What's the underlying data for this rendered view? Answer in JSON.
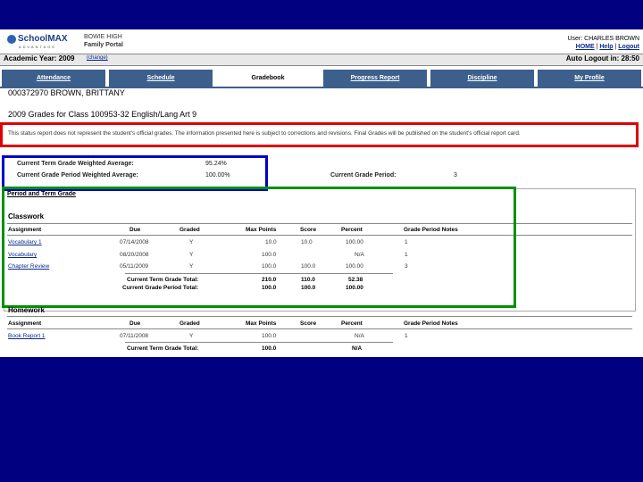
{
  "header": {
    "logo_main": "SchoolMAX",
    "logo_sub": "ADVANTAGE",
    "school": "BOWIE HIGH",
    "portal": "Family Portal",
    "user_label": "User: CHARLES BROWN",
    "home": "HOME",
    "help": "Help",
    "logout": "Logout",
    "sep": "|"
  },
  "yearbar": {
    "label": "Academic Year: 2009",
    "change": "(change)",
    "auto_logout": "Auto Logout in: 28:50"
  },
  "tabs": [
    {
      "label": "Attendance"
    },
    {
      "label": "Schedule"
    },
    {
      "label": "Gradebook"
    },
    {
      "label": "Progress Report"
    },
    {
      "label": "Discipline"
    },
    {
      "label": "My Profile"
    }
  ],
  "student": "000372970 BROWN, BRITTANY",
  "class_line": "2009 Grades for Class 100953-32 English/Lang Art 9",
  "disclaimer": "This status report does not represent the student's official grades. The information presented here is subject to corrections and revisions. Final Grades will be published on the student's official report card.",
  "averages": {
    "term_label": "Current Term Grade Weighted Average:",
    "term_value": "95.24%",
    "period_label": "Current Grade Period Weighted Average:",
    "period_value": "100.00%",
    "current_period_label": "Current Grade Period:",
    "current_period_value": "3"
  },
  "period_frame_title": "Period and Term Grade",
  "columns": {
    "assignment": "Assignment",
    "due": "Due",
    "graded": "Graded",
    "max": "Max Points",
    "score": "Score",
    "percent": "Percent",
    "notes": "Grade Period Notes"
  },
  "classwork": {
    "title": "Classwork",
    "rows": [
      {
        "assignment": "Vocabulary 1",
        "due": "07/14/2008",
        "graded": "Y",
        "max": "10.0",
        "score": "10.0",
        "percent": "100.00",
        "notes": "1"
      },
      {
        "assignment": "Vocabulary",
        "due": "08/20/2008",
        "graded": "Y",
        "max": "100.0",
        "score": "",
        "percent": "N/A",
        "notes": "1"
      },
      {
        "assignment": "Chapter Review",
        "due": "05/11/2009",
        "graded": "Y",
        "max": "100.0",
        "score": "100.0",
        "percent": "100.00",
        "notes": "3"
      }
    ],
    "term_total_label": "Current Term Grade Total:",
    "term_total": {
      "max": "210.0",
      "score": "110.0",
      "percent": "52.38"
    },
    "period_total_label": "Current Grade Period Total:",
    "period_total": {
      "max": "100.0",
      "score": "100.0",
      "percent": "100.00"
    }
  },
  "homework": {
    "title": "Homework",
    "rows": [
      {
        "assignment": "Book Report 1",
        "due": "07/11/2008",
        "graded": "Y",
        "max": "100.0",
        "score": "",
        "percent": "N/A",
        "notes": "1"
      }
    ],
    "term_total_label": "Current Term Grade Total:",
    "term_total": {
      "max": "100.0",
      "score": "",
      "percent": "N/A"
    }
  },
  "colors": {
    "background": "#000080",
    "tab": "#3c5f8c",
    "red_highlight": "#e00000",
    "blue_highlight": "#0000cc",
    "green_highlight": "#009000"
  }
}
